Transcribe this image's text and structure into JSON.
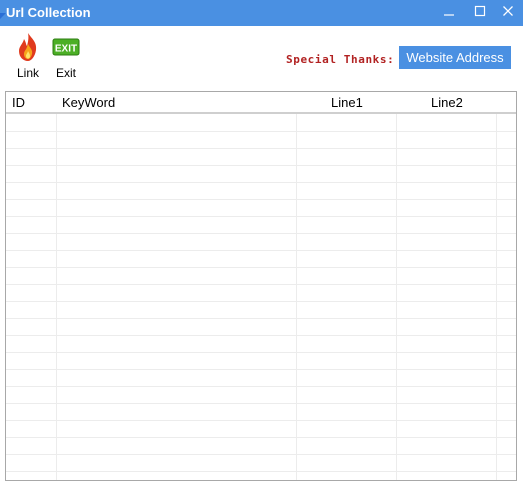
{
  "window": {
    "title": "Url Collection"
  },
  "toolbar": {
    "link_label": "Link",
    "exit_label": "Exit",
    "exit_badge": "EXIT",
    "thanks_text": "Special Thanks:",
    "website_button": "Website Address"
  },
  "table": {
    "columns": [
      "ID",
      "KeyWord",
      "Line1",
      "Line2"
    ],
    "rows": []
  },
  "colors": {
    "accent": "#4a90e2",
    "thanks_red": "#b22222"
  },
  "icons": [
    "app-icon",
    "minimize-icon",
    "maximize-icon",
    "close-icon",
    "fire-icon",
    "exit-icon"
  ]
}
